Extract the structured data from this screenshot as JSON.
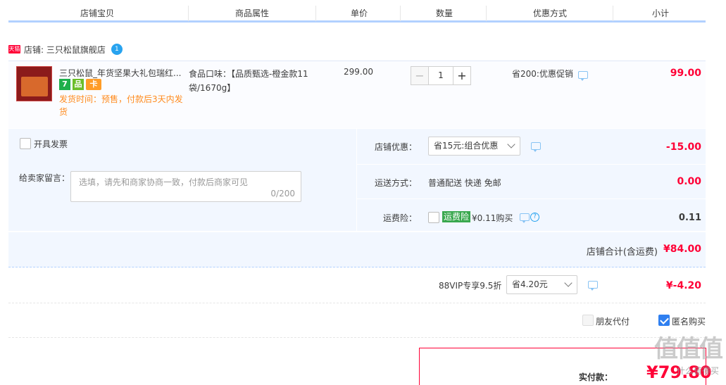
{
  "header": {
    "columns": [
      "店铺宝贝",
      "商品属性",
      "单价",
      "数量",
      "优惠方式",
      "小计"
    ]
  },
  "shop": {
    "badge": "天猫",
    "label": "店铺: 三只松鼠旗舰店",
    "chat_badge": "1"
  },
  "item": {
    "title": "三只松鼠_年货坚果大礼包瑞红...",
    "ship_time": "发货时间：预售，付款后3天内发货",
    "icons": [
      "7",
      "品",
      "卡"
    ],
    "attr": "食品口味：【品质甄选-橙金款11袋/1670g】",
    "unit_price": "299.00",
    "quantity": "1",
    "promo": "省200:优惠促销",
    "subtotal": "99.00"
  },
  "options": {
    "invoice_label": "开具发票",
    "message_label": "给卖家留言：",
    "message_placeholder": "选填，请先和商家协商一致，付款后商家可见",
    "message_count": "0/200",
    "shop_discount_label": "店铺优惠：",
    "shop_discount_select": "省15元:组合优惠",
    "shop_discount_amount": "-15.00",
    "shipping_label": "运送方式：",
    "shipping_value": "普通配送 快递 免邮",
    "shipping_amount": "0.00",
    "insurance_label": "运费险：",
    "insurance_tag": "运费险",
    "insurance_price": "¥0.11购买",
    "insurance_amount": "0.11"
  },
  "totals": {
    "shop_total_label": "店铺合计(含运费)",
    "shop_total_value": "¥84.00",
    "vip_label": "88VIP专享9.5折",
    "vip_select": "省4.20元",
    "vip_amount": "¥-4.20",
    "friend_pay": "朋友代付",
    "anonymous": "匿名购买",
    "actual_label": "实付款：",
    "actual_value": "¥79.80"
  },
  "watermark": {
    "brand": "值值值",
    "sub": "什么值得买"
  },
  "colors": {
    "accent_red": "#ff0036",
    "accent_blue": "#2f7ff0",
    "panel_bg": "#f2f7ff"
  }
}
